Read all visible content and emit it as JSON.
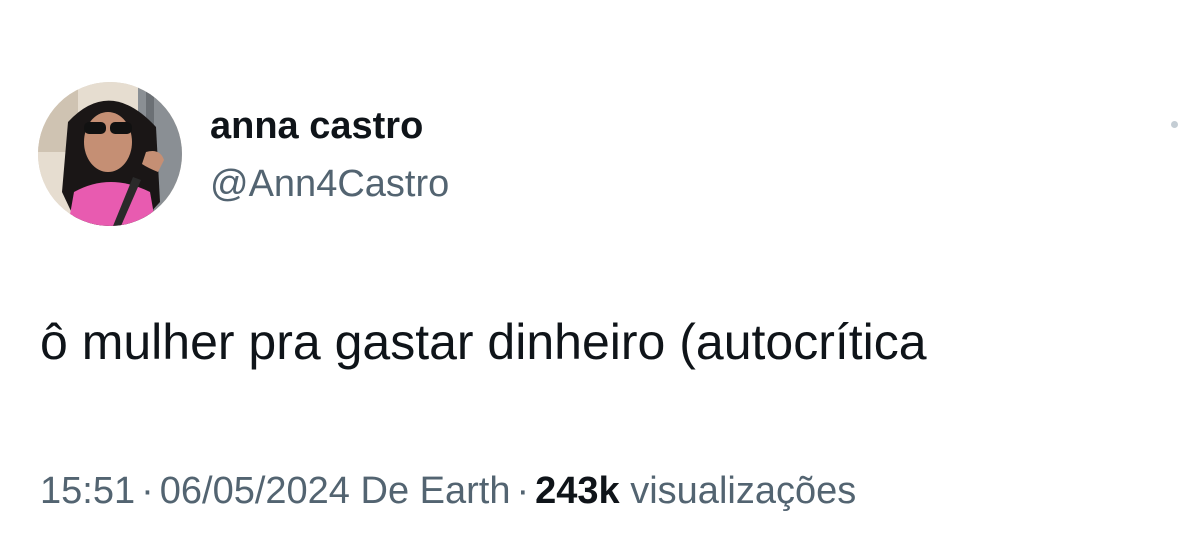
{
  "author": {
    "display_name": "anna castro",
    "handle": "@Ann4Castro"
  },
  "tweet": {
    "text": "ô mulher pra gastar dinheiro (autocrítica"
  },
  "meta": {
    "time": "15:51",
    "separator": "·",
    "date": "06/05/2024",
    "source": "De Earth",
    "views_count": "243k",
    "views_label": "visualizações"
  },
  "icons": {
    "avatar": "profile-photo",
    "more": "more-options-icon"
  },
  "colors": {
    "primary_text": "#0f1419",
    "secondary_text": "#536471",
    "background": "#ffffff"
  }
}
